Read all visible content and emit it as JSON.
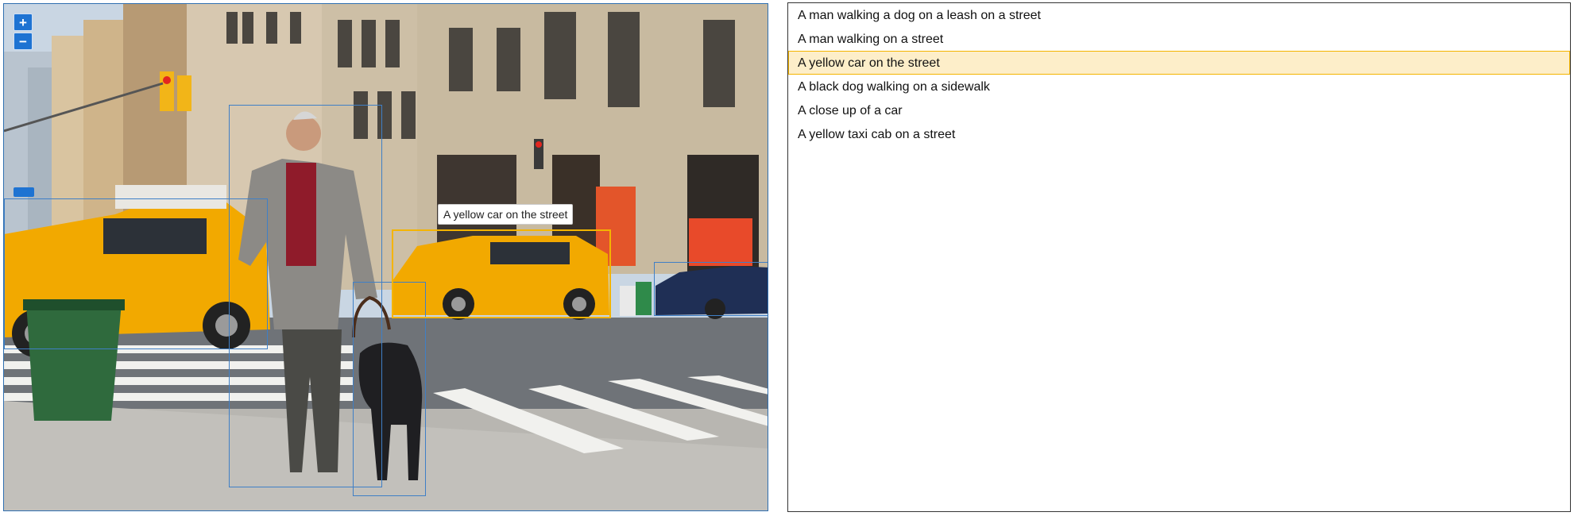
{
  "viewer": {
    "zoom_in_label": "+",
    "zoom_out_label": "−",
    "tooltip": "A yellow car on the street",
    "colors": {
      "box": "#3f7fc6",
      "selected_box": "#f4b400",
      "controls": "#1e73d2"
    }
  },
  "captions": [
    {
      "text": "A man walking a dog on a leash on a street",
      "selected": false
    },
    {
      "text": "A man walking on a street",
      "selected": false
    },
    {
      "text": "A yellow car on the street",
      "selected": true
    },
    {
      "text": "A black dog walking on a sidewalk",
      "selected": false
    },
    {
      "text": "A close up of a car",
      "selected": false
    },
    {
      "text": "A yellow taxi cab on a street",
      "selected": false
    }
  ]
}
